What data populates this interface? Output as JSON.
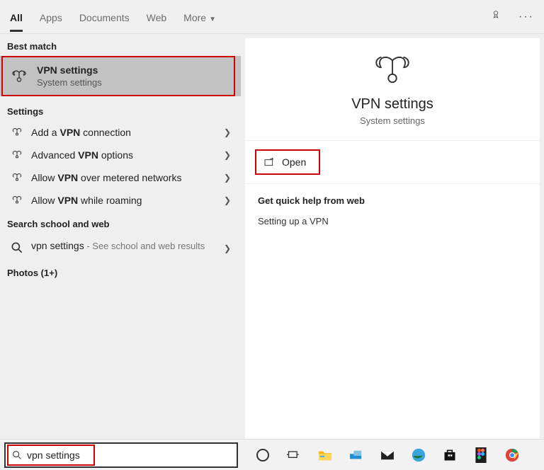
{
  "tabs": {
    "all": "All",
    "apps": "Apps",
    "documents": "Documents",
    "web": "Web",
    "more": "More"
  },
  "left": {
    "best_match_header": "Best match",
    "best_match": {
      "title": "VPN settings",
      "subtitle": "System settings"
    },
    "settings_header": "Settings",
    "items": [
      {
        "pre": "Add a ",
        "bold": "VPN",
        "post": " connection"
      },
      {
        "pre": "Advanced ",
        "bold": "VPN",
        "post": " options"
      },
      {
        "pre": "Allow ",
        "bold": "VPN",
        "post": " over metered networks"
      },
      {
        "pre": "Allow ",
        "bold": "VPN",
        "post": " while roaming"
      }
    ],
    "search_web_header": "Search school and web",
    "search_web_item": {
      "term": "vpn settings",
      "suffix": " - See school and web results"
    },
    "photos_header": "Photos (1+)"
  },
  "right": {
    "title": "VPN settings",
    "subtitle": "System settings",
    "open": "Open",
    "help_header": "Get quick help from web",
    "help_link": "Setting up a VPN"
  },
  "taskbar": {
    "search_value": "vpn settings"
  }
}
